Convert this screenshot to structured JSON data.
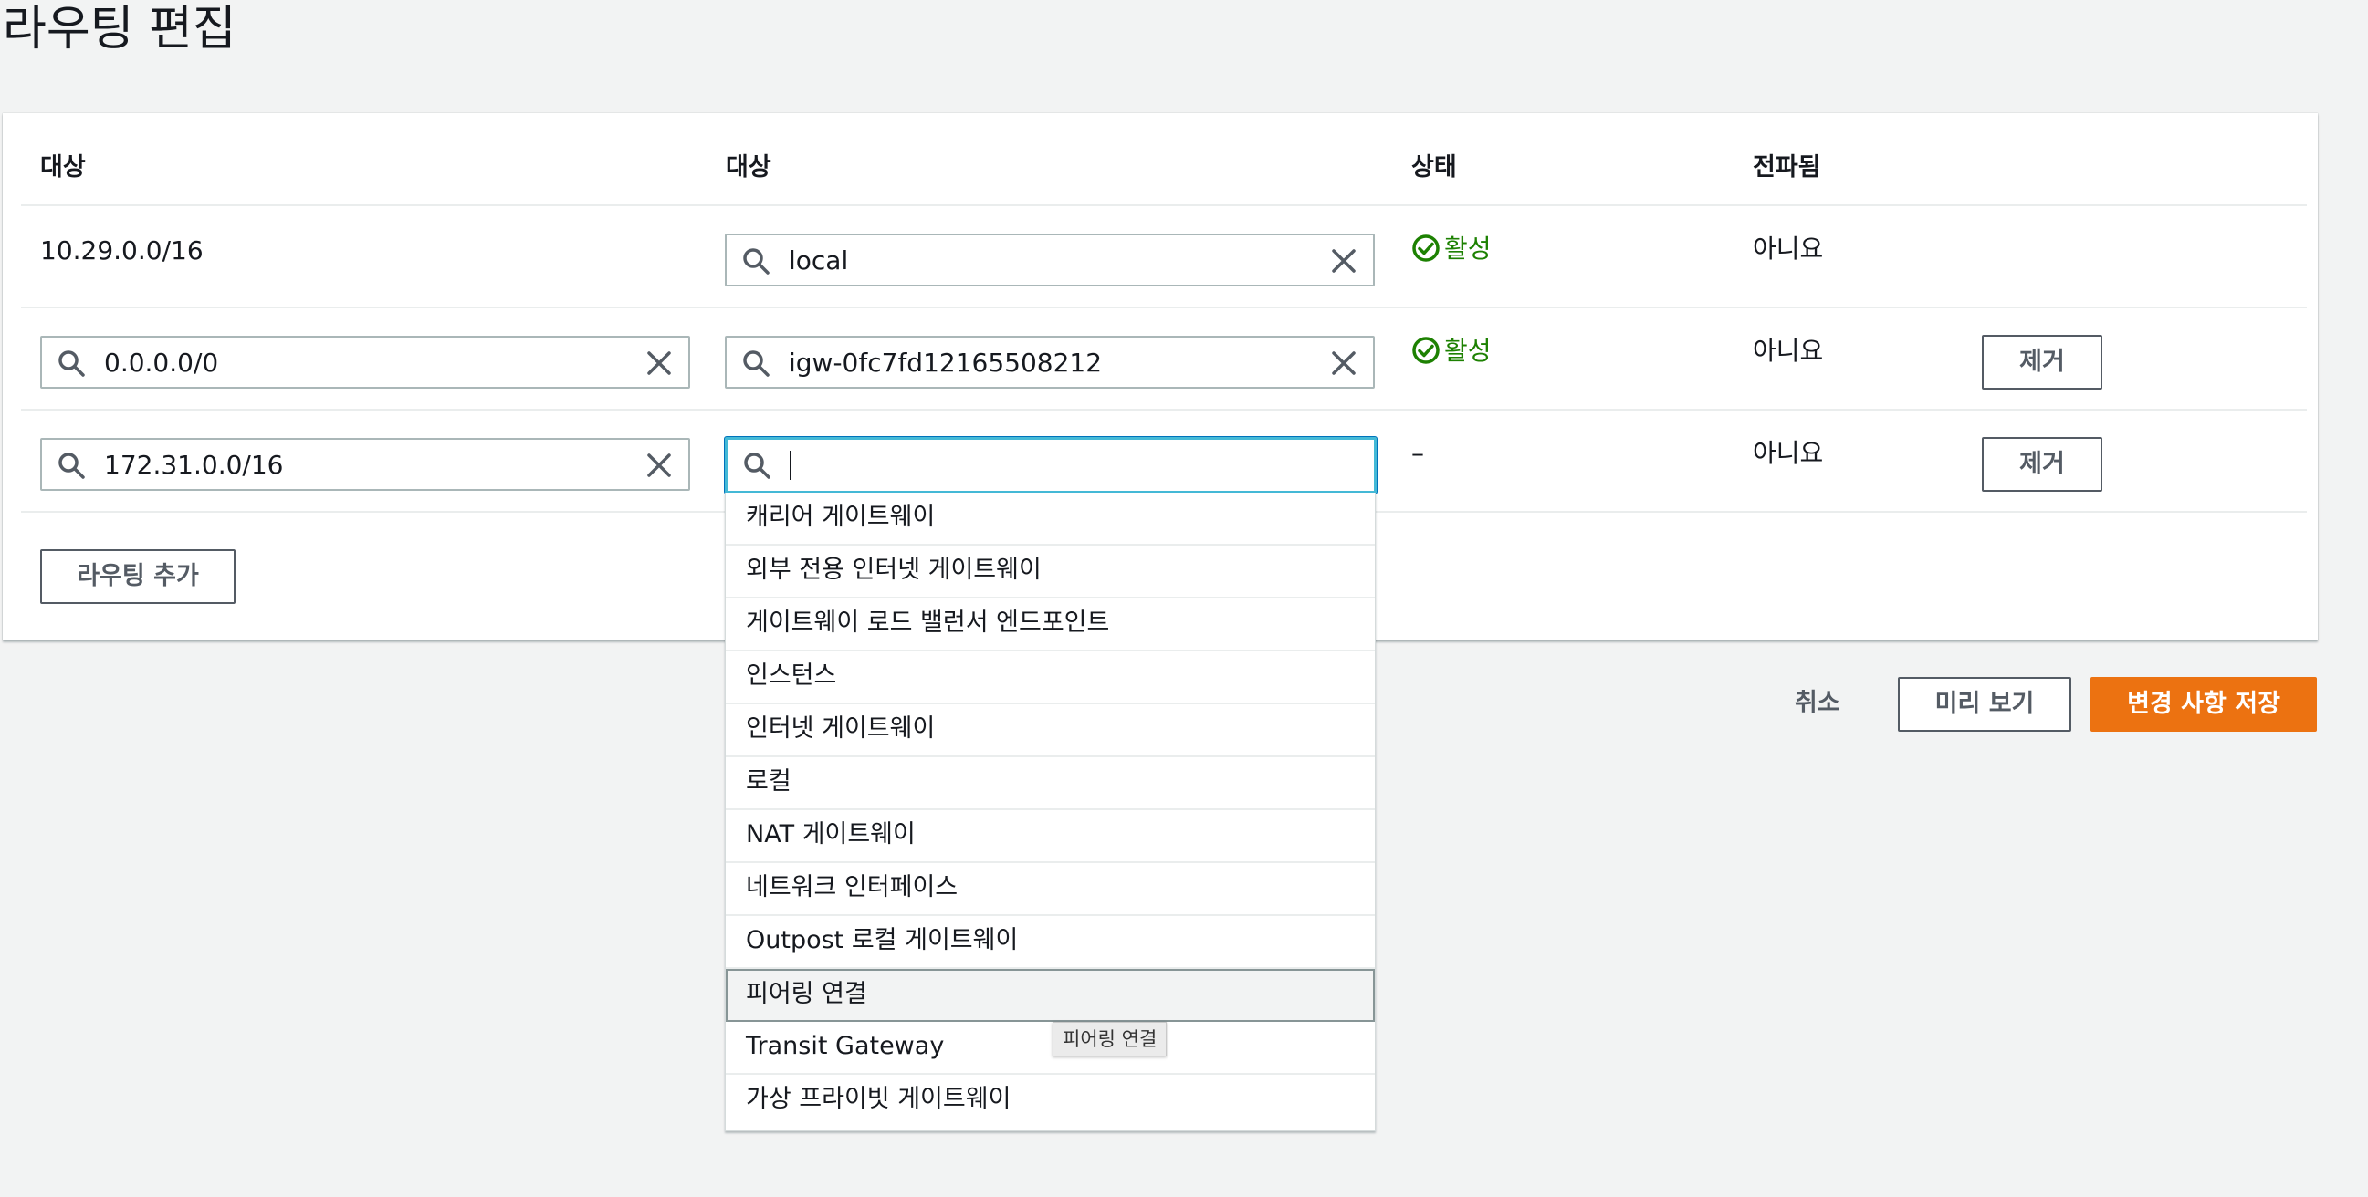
{
  "page": {
    "title": "라우팅 편집"
  },
  "table": {
    "headers": {
      "destination": "대상",
      "target": "대상",
      "status": "상태",
      "propagated": "전파됨"
    },
    "rows": [
      {
        "destination": "10.29.0.0/16",
        "target": "local",
        "status": "활성",
        "propagated": "아니요",
        "remove": ""
      },
      {
        "destination": "0.0.0.0/0",
        "target": "igw-0fc7fd12165508212",
        "status": "활성",
        "propagated": "아니요",
        "remove": "제거"
      },
      {
        "destination": "172.31.0.0/16",
        "target": "",
        "status": "–",
        "propagated": "아니요",
        "remove": "제거"
      }
    ],
    "add_route": "라우팅 추가"
  },
  "dropdown": {
    "options": [
      "캐리어 게이트웨이",
      "외부 전용 인터넷 게이트웨이",
      "게이트웨이 로드 밸런서 엔드포인트",
      "인스턴스",
      "인터넷 게이트웨이",
      "로컬",
      "NAT 게이트웨이",
      "네트워크 인터페이스",
      "Outpost 로컬 게이트웨이",
      "피어링 연결",
      "Transit Gateway",
      "가상 프라이빗 게이트웨이"
    ],
    "highlighted": "피어링 연결",
    "tooltip": "피어링 연결"
  },
  "actions": {
    "cancel": "취소",
    "preview": "미리 보기",
    "save": "변경 사항 저장"
  },
  "colors": {
    "accent_orange": "#ec7211",
    "status_green": "#1d8102",
    "focus_blue": "#44b9d6"
  },
  "icons": {
    "search": "search-icon",
    "clear": "close-icon",
    "status_ok": "check-circle-icon"
  }
}
